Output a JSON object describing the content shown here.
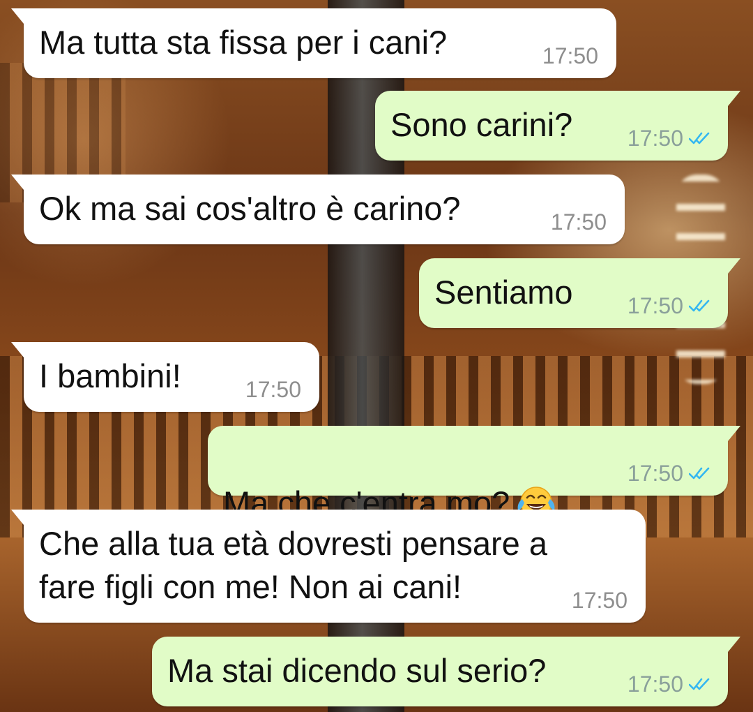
{
  "colors": {
    "incoming_bubble": "#ffffff",
    "outgoing_bubble": "#e1fcc7",
    "read_ticks": "#34b7f1",
    "timestamp": "#8e8e8e"
  },
  "messages": [
    {
      "direction": "incoming",
      "text": "Ma tutta sta fissa per i cani?",
      "time": "17:50"
    },
    {
      "direction": "outgoing",
      "text": "Sono carini?",
      "time": "17:50",
      "status": "read"
    },
    {
      "direction": "incoming",
      "text": "Ok ma sai cos'altro è carino?",
      "time": "17:50"
    },
    {
      "direction": "outgoing",
      "text": "Sentiamo",
      "time": "17:50",
      "status": "read"
    },
    {
      "direction": "incoming",
      "text": "I bambini!",
      "time": "17:50"
    },
    {
      "direction": "outgoing",
      "text": "Ma che c'entra mo?",
      "emoji": "face-with-tears-of-joy",
      "time": "17:50",
      "status": "read"
    },
    {
      "direction": "incoming",
      "text": "Che alla tua età dovresti pensare a\nfare figli con me! Non ai cani!",
      "time": "17:50"
    },
    {
      "direction": "outgoing",
      "text": "Ma stai dicendo sul serio?",
      "time": "17:50",
      "status": "read"
    }
  ]
}
